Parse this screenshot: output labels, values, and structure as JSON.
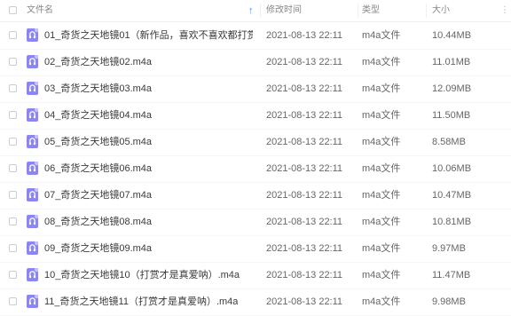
{
  "header": {
    "name_label": "文件名",
    "time_label": "修改时间",
    "type_label": "类型",
    "size_label": "大小",
    "sort_icon": "arrow-up-icon",
    "menu_icon": "more-icon"
  },
  "files": [
    {
      "name": "01_奇货之天地镜01（新作品，喜欢不喜欢都打赏呗～）....",
      "time": "2021-08-13 22:11",
      "type": "m4a文件",
      "size": "10.44MB"
    },
    {
      "name": "02_奇货之天地镜02.m4a",
      "time": "2021-08-13 22:11",
      "type": "m4a文件",
      "size": "11.01MB"
    },
    {
      "name": "03_奇货之天地镜03.m4a",
      "time": "2021-08-13 22:11",
      "type": "m4a文件",
      "size": "12.09MB"
    },
    {
      "name": "04_奇货之天地镜04.m4a",
      "time": "2021-08-13 22:11",
      "type": "m4a文件",
      "size": "11.50MB"
    },
    {
      "name": "05_奇货之天地镜05.m4a",
      "time": "2021-08-13 22:11",
      "type": "m4a文件",
      "size": "8.58MB"
    },
    {
      "name": "06_奇货之天地镜06.m4a",
      "time": "2021-08-13 22:11",
      "type": "m4a文件",
      "size": "10.06MB"
    },
    {
      "name": "07_奇货之天地镜07.m4a",
      "time": "2021-08-13 22:11",
      "type": "m4a文件",
      "size": "10.47MB"
    },
    {
      "name": "08_奇货之天地镜08.m4a",
      "time": "2021-08-13 22:11",
      "type": "m4a文件",
      "size": "10.81MB"
    },
    {
      "name": "09_奇货之天地镜09.m4a",
      "time": "2021-08-13 22:11",
      "type": "m4a文件",
      "size": "9.97MB"
    },
    {
      "name": "10_奇货之天地镜10（打赏才是真爱呐）.m4a",
      "time": "2021-08-13 22:11",
      "type": "m4a文件",
      "size": "11.47MB"
    },
    {
      "name": "11_奇货之天地镜11（打赏才是真爱呐）.m4a",
      "time": "2021-08-13 22:11",
      "type": "m4a文件",
      "size": "9.98MB"
    }
  ],
  "colors": {
    "accent": "#3b8cff",
    "file_icon": "#8c86f2"
  }
}
